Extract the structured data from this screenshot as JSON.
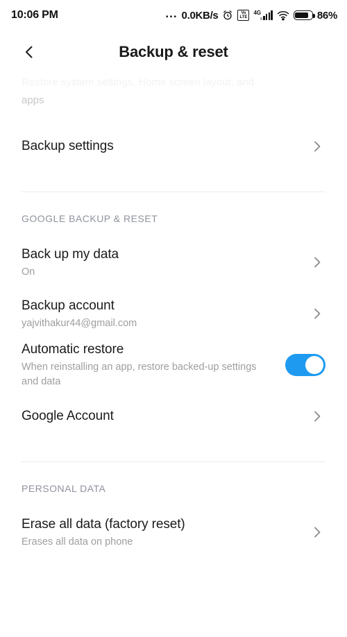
{
  "statusbar": {
    "time": "10:06 PM",
    "network_dots": "...",
    "network_speed": "0.0KB/s",
    "alarm_icon": "alarm-clock-icon",
    "volte_top": "Vo",
    "volte_bottom": "LTE",
    "mobile_network": "4G",
    "wifi_icon": "wifi-icon",
    "battery_icon": "battery-icon",
    "battery_percent": "86%"
  },
  "appbar": {
    "back_icon": "back-chevron-icon",
    "title": "Backup & reset"
  },
  "scrolled_text": {
    "line1": "Restore system settings, Home screen layout, and",
    "line2": "apps"
  },
  "backup_settings": {
    "title": "Backup settings",
    "chevron": "chevron-right-icon"
  },
  "sections": [
    {
      "header": "GOOGLE BACKUP & RESET",
      "rows": [
        {
          "title": "Back up my data",
          "subtitle": "On",
          "control": "chevron"
        },
        {
          "title": "Backup account",
          "subtitle": "yajvithakur44@gmail.com",
          "control": "chevron"
        },
        {
          "title": "Automatic restore",
          "subtitle": "When reinstalling an app, restore backed-up settings and data",
          "control": "toggle",
          "toggle_on": true
        },
        {
          "title": "Google Account",
          "subtitle": "",
          "control": "chevron"
        }
      ]
    },
    {
      "header": "PERSONAL DATA",
      "rows": [
        {
          "title": "Erase all data (factory reset)",
          "subtitle": "Erases all data on phone",
          "control": "chevron"
        }
      ]
    }
  ],
  "colors": {
    "accent": "#1e9bf0",
    "title": "#1a1a1a",
    "subtitle": "#9e9e9e",
    "section_header": "#8f939e",
    "divider": "#ececec",
    "chevron": "#8a8a8a"
  }
}
